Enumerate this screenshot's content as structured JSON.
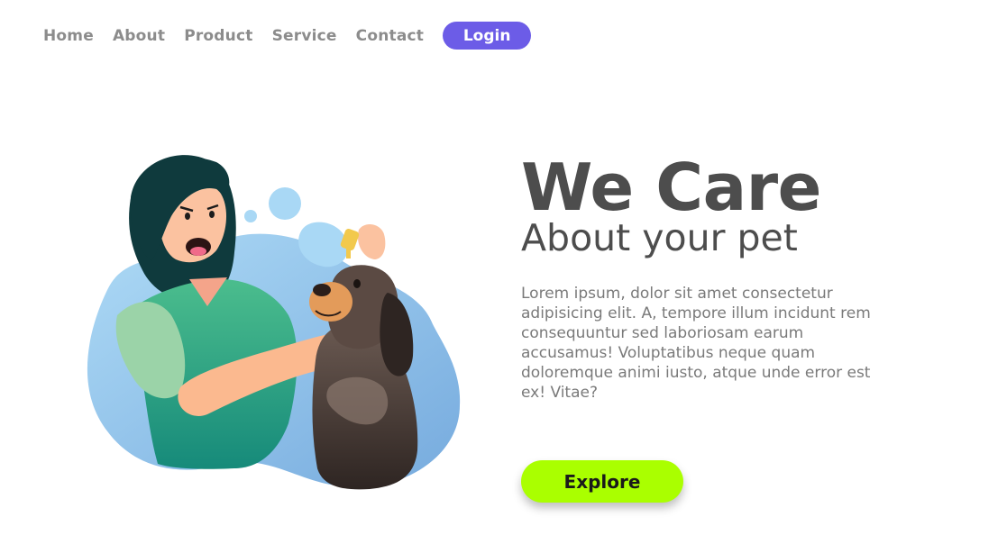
{
  "nav": {
    "items": [
      {
        "label": "Home"
      },
      {
        "label": "About"
      },
      {
        "label": "Product"
      },
      {
        "label": "Service"
      },
      {
        "label": "Contact"
      }
    ],
    "login_label": "Login"
  },
  "hero": {
    "title": "We Care",
    "subtitle": "About your pet",
    "body": "Lorem ipsum, dolor sit amet consectetur adipisicing elit. A, tempore illum incidunt rem consequuntur sed laboriosam earum accusamus! Voluptatibus neque quam doloremque animi iusto, atque unde error est ex! Vitae?",
    "cta_label": "Explore"
  },
  "colors": {
    "accent": "#6c5ce7",
    "cta": "#aaff00",
    "heading": "#4d4d4d",
    "nav_text": "#8c8c8c"
  },
  "illustration": {
    "icon": "woman-giving-dog-eye-drops-illustration"
  }
}
